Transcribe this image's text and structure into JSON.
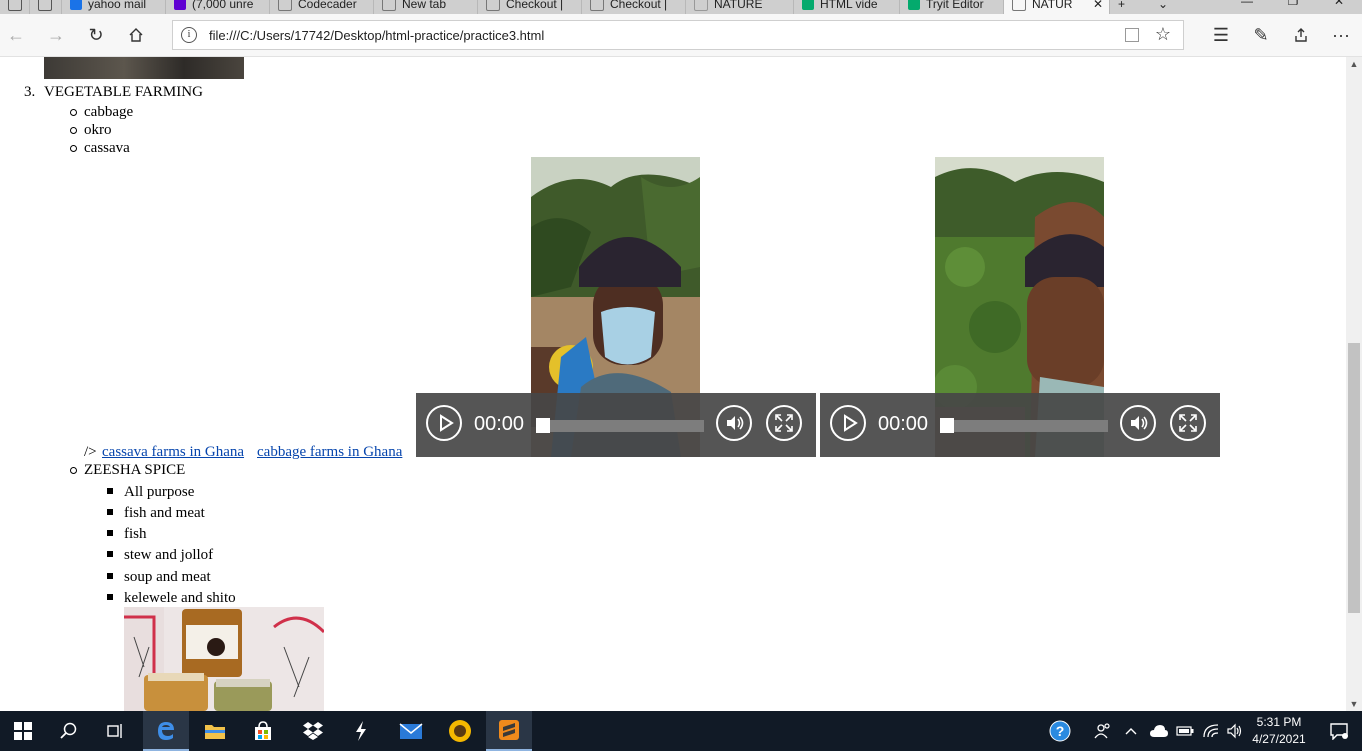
{
  "browser": {
    "tabs": [
      {
        "title": "",
        "favicon_color": "#666666",
        "active": false
      },
      {
        "title": "",
        "favicon_color": "#666666",
        "active": false
      },
      {
        "title": "yahoo mail",
        "favicon_color": "#1a73e8",
        "active": false
      },
      {
        "title": "(7,000 unre",
        "favicon_color": "#6001d2",
        "active": false
      },
      {
        "title": "Codecader",
        "favicon_color": "#777777",
        "active": false
      },
      {
        "title": "New tab",
        "favicon_color": "#777777",
        "active": false
      },
      {
        "title": "Checkout |",
        "favicon_color": "#777777",
        "active": false
      },
      {
        "title": "Checkout |",
        "favicon_color": "#777777",
        "active": false
      },
      {
        "title": "NATURE",
        "favicon_color": "#999999",
        "active": false
      },
      {
        "title": "HTML vide",
        "favicon_color": "#04aa6d",
        "active": false
      },
      {
        "title": "Tryit Editor",
        "favicon_color": "#04aa6d",
        "active": false
      },
      {
        "title": "NATUR",
        "favicon_color": "#999999",
        "active": true
      }
    ],
    "url": "file:///C:/Users/17742/Desktop/html-practice/practice3.html"
  },
  "page": {
    "list_item_number": "3.",
    "heading": "VEGETABLE FARMING",
    "vegetables": [
      "cabbage",
      "okro",
      "cassava"
    ],
    "stray_text": "/>",
    "links": [
      "cassava farms in Ghana",
      "cabbage farms in Ghana"
    ],
    "spice_heading": "ZEESHA SPICE",
    "spice_items": [
      "All purpose",
      "fish and meat",
      "fish",
      "stew and jollof",
      "soup and meat",
      "kelewele and shito"
    ],
    "videos": [
      {
        "time": "00:00",
        "progress": 0
      },
      {
        "time": "00:00",
        "progress": 0
      }
    ]
  },
  "taskbar": {
    "time": "5:31 PM",
    "date": "4/27/2021",
    "apps": [
      "start-icon",
      "search-icon",
      "task-view-icon",
      "edge-icon",
      "file-explorer-icon",
      "store-icon",
      "dropbox-icon",
      "app-icon",
      "mail-icon",
      "sunflower-icon",
      "sublime-text-icon"
    ]
  }
}
